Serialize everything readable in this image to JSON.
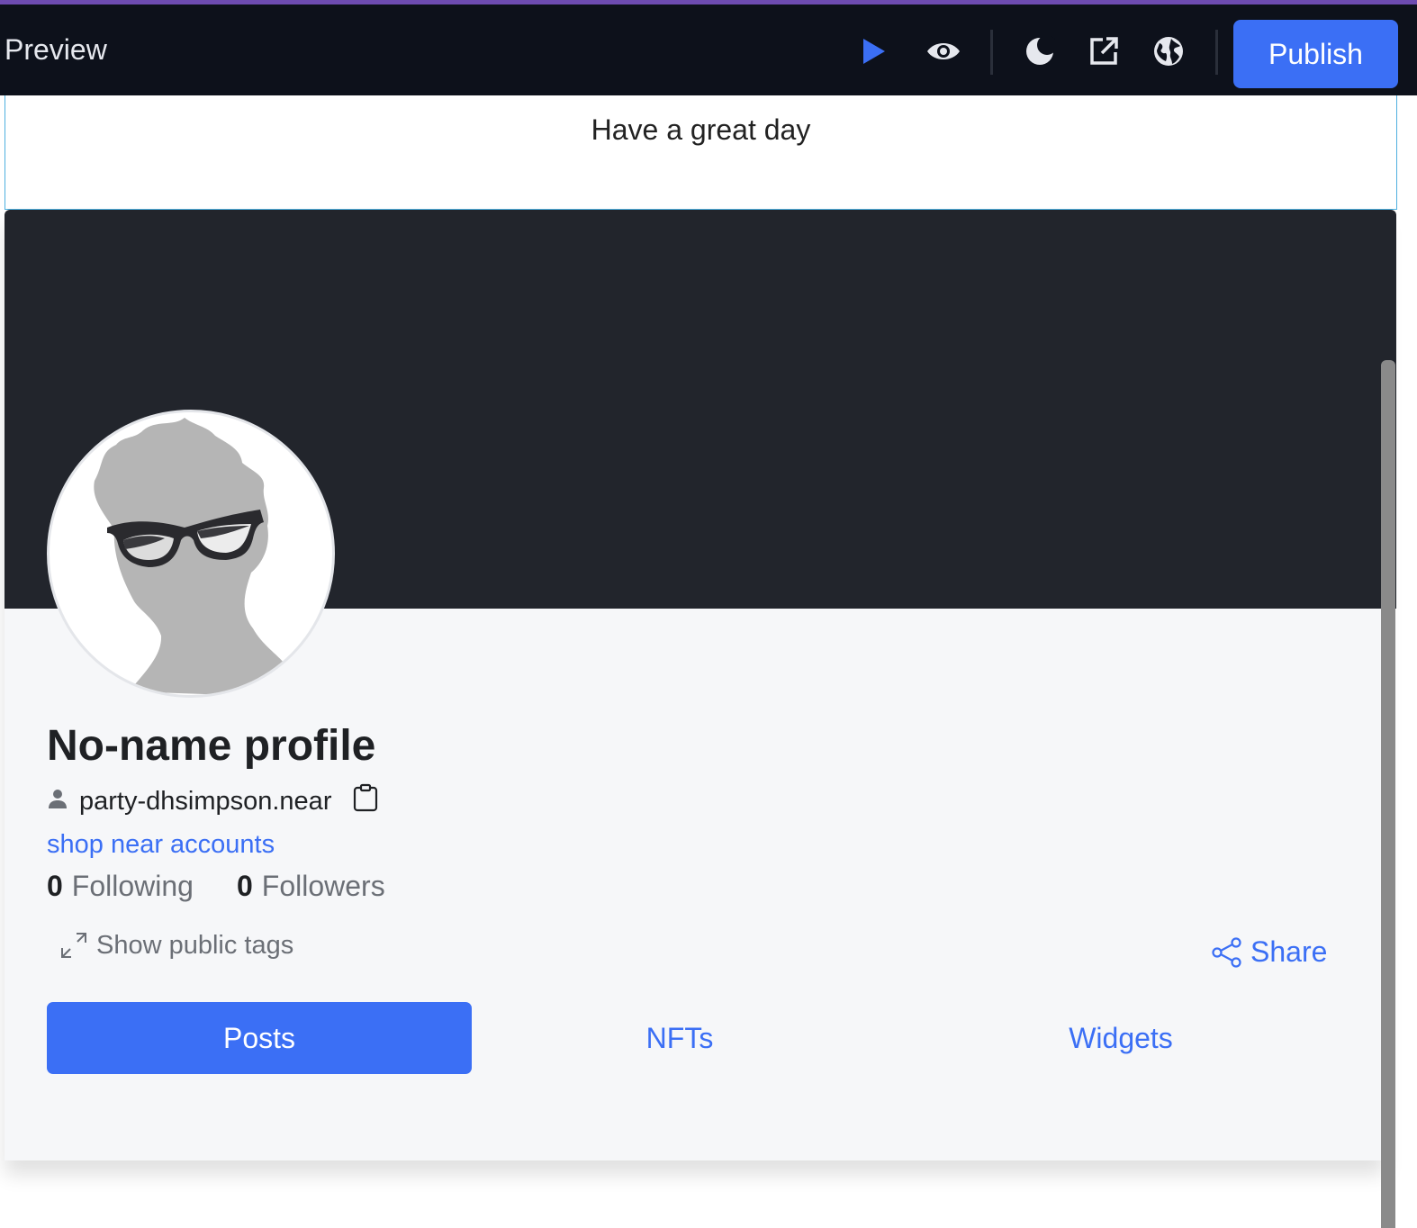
{
  "toolbar": {
    "title": "Preview",
    "icons": [
      "play-icon",
      "eye-icon",
      "moon-icon",
      "external-link-icon",
      "globe-icon"
    ],
    "publish_label": "Publish"
  },
  "greeting": "Have a great day",
  "profile": {
    "name": "No-name profile",
    "account": "party-dhsimpson.near",
    "link": "shop near accounts",
    "following_count": "0",
    "following_label": "Following",
    "followers_count": "0",
    "followers_label": "Followers",
    "tags_label": "Show public tags",
    "share_label": "Share"
  },
  "tabs": [
    {
      "label": "Posts",
      "active": true
    },
    {
      "label": "NFTs",
      "active": false
    },
    {
      "label": "Widgets",
      "active": false
    }
  ],
  "colors": {
    "accent": "#3b6ff5",
    "toolbar_bg": "#0d111b",
    "banner_bg": "#22252c",
    "card_bg": "#f6f7f9",
    "top_line": "#6d4bb0"
  }
}
